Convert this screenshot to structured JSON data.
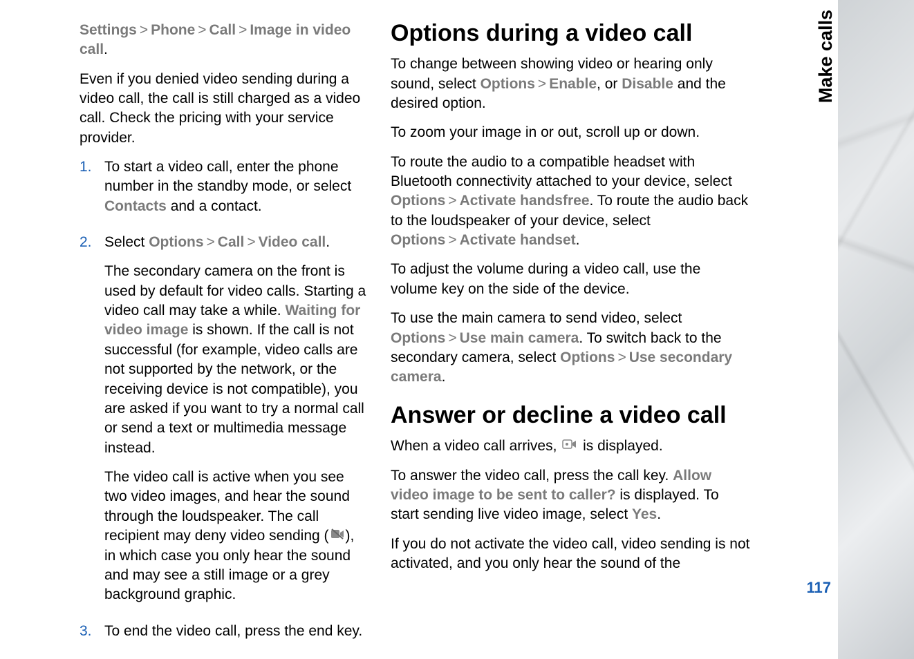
{
  "leftCol": {
    "breadcrumb": {
      "p1": "Settings",
      "p2": "Phone",
      "p3": "Call",
      "p4": "Image in video call",
      "terminalPunct": "."
    },
    "intro": "Even if you denied video sending during a video call, the call is still charged as a video call. Check the pricing with your service provider.",
    "steps": {
      "s1_num": "1.",
      "s1_a": "To start a video call, enter the phone number in the standby mode, or select ",
      "s1_contacts": "Contacts",
      "s1_b": " and a contact.",
      "s2_num": "2.",
      "s2_a": "Select ",
      "s2_options": "Options",
      "s2_call": "Call",
      "s2_video": "Video call",
      "s2_punct": ".",
      "s2_p2a": "The secondary camera on the front is used by default for video calls. Starting a video call may take a while. ",
      "s2_waiting": "Waiting for video image",
      "s2_p2b": " is shown. If the call is not successful (for example, video calls are not supported by the network, or the receiving device is not compatible), you are asked if you want to try a normal call or send a text or multimedia message instead.",
      "s2_p3a": "The video call is active when you see two video images, and hear the sound through the loudspeaker. The call recipient may deny video sending (",
      "s2_p3b": "), in which case you only hear the sound and may see a still image or a grey background graphic.",
      "s3_num": "3.",
      "s3": "To end the video call, press the end key."
    }
  },
  "rightCol": {
    "h1": "Options during a video call",
    "p1a": "To change between showing video or hearing only sound, select ",
    "p1_options": "Options",
    "p1_enable": "Enable",
    "p1_mid": ", or ",
    "p1_disable": "Disable",
    "p1b": " and the desired option.",
    "p2": "To zoom your image in or out, scroll up or down.",
    "p3a": "To route the audio to a compatible headset with Bluetooth connectivity attached to your device, select ",
    "p3_options": "Options",
    "p3_hf": "Activate handsfree",
    "p3b": ". To route the audio back to the loudspeaker of your device, select ",
    "p3_options2": "Options",
    "p3_hs": "Activate handset",
    "p3c": ".",
    "p4": "To adjust the volume during a video call, use the volume key on the side of the device.",
    "p5a": "To use the main camera to send video, select ",
    "p5_options": "Options",
    "p5_main": "Use main camera",
    "p5b": ". To switch back to the secondary camera, select ",
    "p5_options2": "Options",
    "p5_sec": "Use secondary camera",
    "p5c": ".",
    "h2": "Answer or decline a video call",
    "p6a": "When a video call arrives, ",
    "p6b": " is displayed.",
    "p7a": "To answer the video call, press the call key. ",
    "p7_allow": "Allow video image to be sent to caller?",
    "p7b": " is displayed. To start sending live video image, select ",
    "p7_yes": "Yes",
    "p7c": ".",
    "p8": "If you do not activate the video call, video sending is not activated, and you only hear the sound of the"
  },
  "sidebar": "Make calls",
  "pageNumber": "117"
}
